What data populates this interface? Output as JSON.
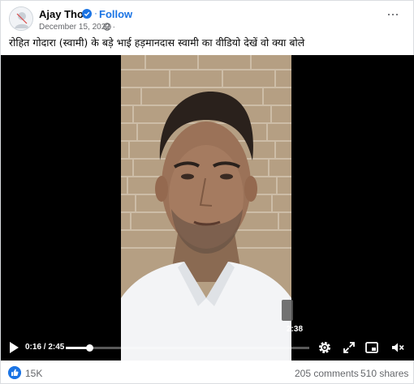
{
  "post": {
    "author": "Ajay Thori",
    "follow_label": "Follow",
    "dot": "·",
    "date": "December 15, 2022 ·",
    "caption": "रोहित गोदारा (स्वामी) के बड़े भाई हड़मानदास स्वामी का वीडियो देखें वो क्या बोले",
    "more_label": "···"
  },
  "video": {
    "current_time": "0:16",
    "duration": "2:45",
    "time_display": "0:16 / 2:45",
    "progress_fraction": 0.097,
    "chapter_time": "2:38"
  },
  "footer": {
    "reactions": "15K",
    "comments": "205 comments",
    "shares": "510 shares"
  },
  "colors": {
    "accent": "#1b74e4",
    "muted": "#65676b"
  },
  "icons": [
    "globe-icon",
    "verified-icon",
    "play-icon",
    "settings-icon",
    "expand-icon",
    "picture-in-picture-icon",
    "fullscreen-icon",
    "volume-muted-icon",
    "like-icon"
  ]
}
